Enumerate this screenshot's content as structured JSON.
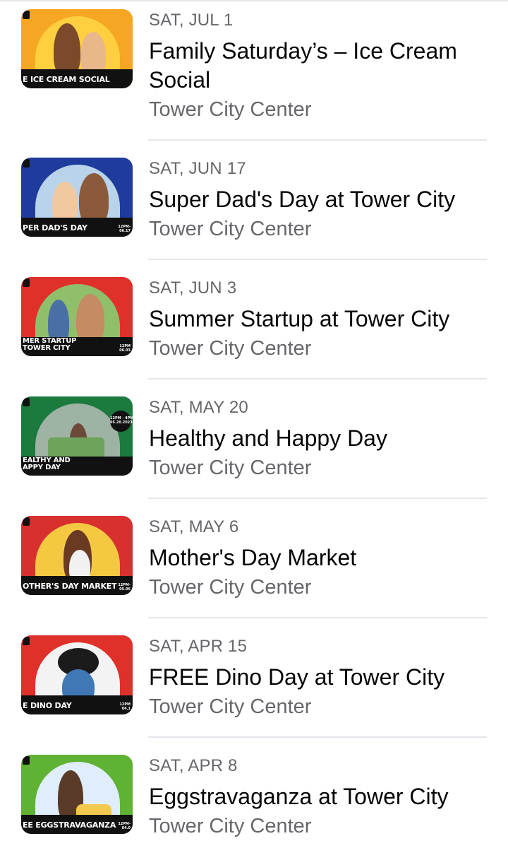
{
  "events": [
    {
      "date": "SAT, JUL 1",
      "title": "Family Saturday’s – Ice Cream Social",
      "venue": "Tower City Center",
      "thumb_label": "E ICE CREAM SOCIAL",
      "thumb_time": "",
      "bg": "#f5a623",
      "arch": "#ffcf3f"
    },
    {
      "date": "SAT, JUN 17",
      "title": "Super Dad's Day at Tower City",
      "venue": "Tower City Center",
      "thumb_label": "PER DAD'S DAY",
      "thumb_time": "12PM-\n06.17",
      "bg": "#1f3c9c",
      "arch": "#b9d4ea"
    },
    {
      "date": "SAT, JUN 3",
      "title": "Summer Startup at Tower City",
      "venue": "Tower City Center",
      "thumb_label": "MER STARTUP\nTOWER CITY",
      "thumb_time": "12PM\n06.03",
      "bg": "#e0302a",
      "arch": "#8fbf6a"
    },
    {
      "date": "SAT, MAY 20",
      "title": "Healthy and Happy Day",
      "venue": "Tower City Center",
      "thumb_label": "EALTHY AND\nAPPY DAY",
      "thumb_time": "12PM - 4PM\n05.20.2023",
      "bg": "#1c7a3e",
      "arch": "#9fb3a4"
    },
    {
      "date": "SAT, MAY 6",
      "title": "Mother's Day Market",
      "venue": "Tower City Center",
      "thumb_label": "OTHER'S DAY MARKET",
      "thumb_time": "12PM-\n05.06",
      "bg": "#d82f2f",
      "arch": "#f5c842"
    },
    {
      "date": "SAT, APR 15",
      "title": "FREE Dino Day at Tower City",
      "venue": "Tower City Center",
      "thumb_label": "E DINO DAY",
      "thumb_time": "12PM\n04.1",
      "bg": "#e0302a",
      "arch": "#f3f3f3"
    },
    {
      "date": "SAT, APR 8",
      "title": "Eggstravaganza at Tower City",
      "venue": "Tower City Center",
      "thumb_label": "EE EGGSTRAVAGANZA",
      "thumb_time": "12PM-\n04.0",
      "bg": "#5fb233",
      "arch": "#dfeefa"
    }
  ]
}
